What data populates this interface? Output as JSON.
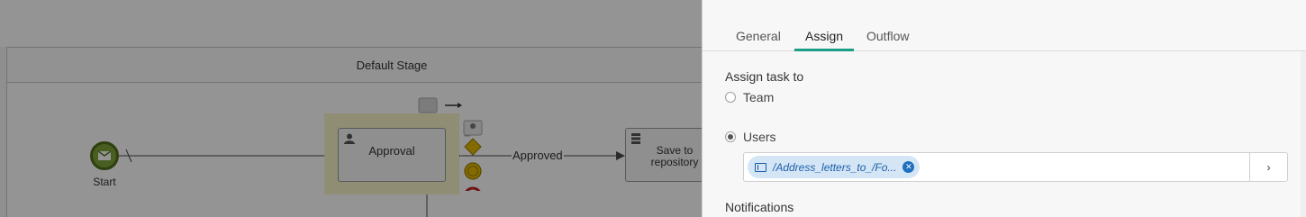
{
  "canvas": {
    "stage_label": "Default Stage",
    "start_label": "Start",
    "approval_label": "Approval",
    "edge_label": "Approved",
    "save_label_line1": "Save to",
    "save_label_line2": "repository"
  },
  "panel": {
    "tabs": [
      {
        "label": "General"
      },
      {
        "label": "Assign"
      },
      {
        "label": "Outflow"
      }
    ],
    "active_tab": "Assign",
    "assign_title": "Assign task to",
    "option_team": "Team",
    "option_users": "Users",
    "selected_option": "Users",
    "user_chip": "/Address_letters_to_/Fo...",
    "browse_icon": "›",
    "notifications_title": "Notifications"
  },
  "colors": {
    "accent": "#1a9e87",
    "chip_bg": "#d4e6f6",
    "chip_text": "#1b5ea8",
    "start_event": "#7fa339",
    "highlight": "#f7f3c7"
  }
}
